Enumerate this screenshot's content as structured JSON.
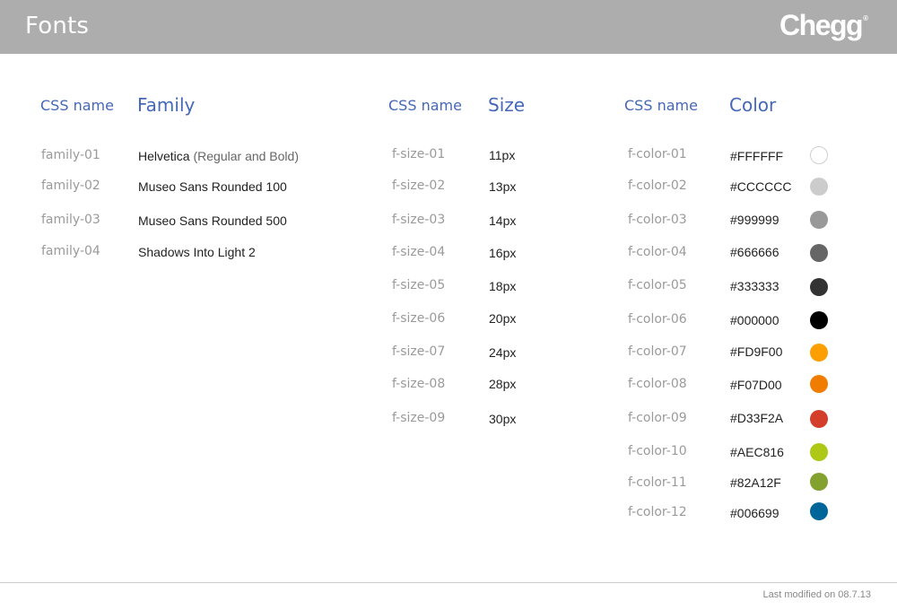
{
  "header": {
    "title": "Fonts",
    "logo_text": "Chegg",
    "logo_mark": "®",
    "background": "#ADADAD"
  },
  "accent_color": "#4567B7",
  "families": {
    "col_name": "CSS name",
    "col_value": "Family",
    "rows": [
      {
        "name": "family-01",
        "value": "Helvetica",
        "extra": "(Regular and Bold)"
      },
      {
        "name": "family-02",
        "value": "Museo Sans Rounded 100",
        "extra": ""
      },
      {
        "name": "family-03",
        "value": "Museo Sans Rounded 500",
        "extra": ""
      },
      {
        "name": "family-04",
        "value": "Shadows Into Light 2",
        "extra": ""
      }
    ]
  },
  "sizes": {
    "col_name": "CSS name",
    "col_value": "Size",
    "rows": [
      {
        "name": "f-size-01",
        "value": "11px"
      },
      {
        "name": "f-size-02",
        "value": "13px"
      },
      {
        "name": "f-size-03",
        "value": "14px"
      },
      {
        "name": "f-size-04",
        "value": "16px"
      },
      {
        "name": "f-size-05",
        "value": "18px"
      },
      {
        "name": "f-size-06",
        "value": "20px"
      },
      {
        "name": "f-size-07",
        "value": "24px"
      },
      {
        "name": "f-size-08",
        "value": "28px"
      },
      {
        "name": "f-size-09",
        "value": "30px"
      }
    ]
  },
  "colors": {
    "col_name": "CSS name",
    "col_value": "Color",
    "rows": [
      {
        "name": "f-color-01",
        "value": "#FFFFFF",
        "swatch": "#FFFFFF"
      },
      {
        "name": "f-color-02",
        "value": "#CCCCCC",
        "swatch": "#CCCCCC"
      },
      {
        "name": "f-color-03",
        "value": "#999999",
        "swatch": "#999999"
      },
      {
        "name": "f-color-04",
        "value": "#666666",
        "swatch": "#666666"
      },
      {
        "name": "f-color-05",
        "value": "#333333",
        "swatch": "#333333"
      },
      {
        "name": "f-color-06",
        "value": "#000000",
        "swatch": "#000000"
      },
      {
        "name": "f-color-07",
        "value": "#FD9F00",
        "swatch": "#FD9F00"
      },
      {
        "name": "f-color-08",
        "value": "#F07D00",
        "swatch": "#F07D00"
      },
      {
        "name": "f-color-09",
        "value": "#D33F2A",
        "swatch": "#D33F2A"
      },
      {
        "name": "f-color-10",
        "value": "#AEC816",
        "swatch": "#AEC816"
      },
      {
        "name": "f-color-11",
        "value": "#82A12F",
        "swatch": "#82A12F"
      },
      {
        "name": "f-color-12",
        "value": "#006699",
        "swatch": "#006699"
      }
    ]
  },
  "footer": {
    "last_modified": "Last modified on 08.7.13"
  }
}
